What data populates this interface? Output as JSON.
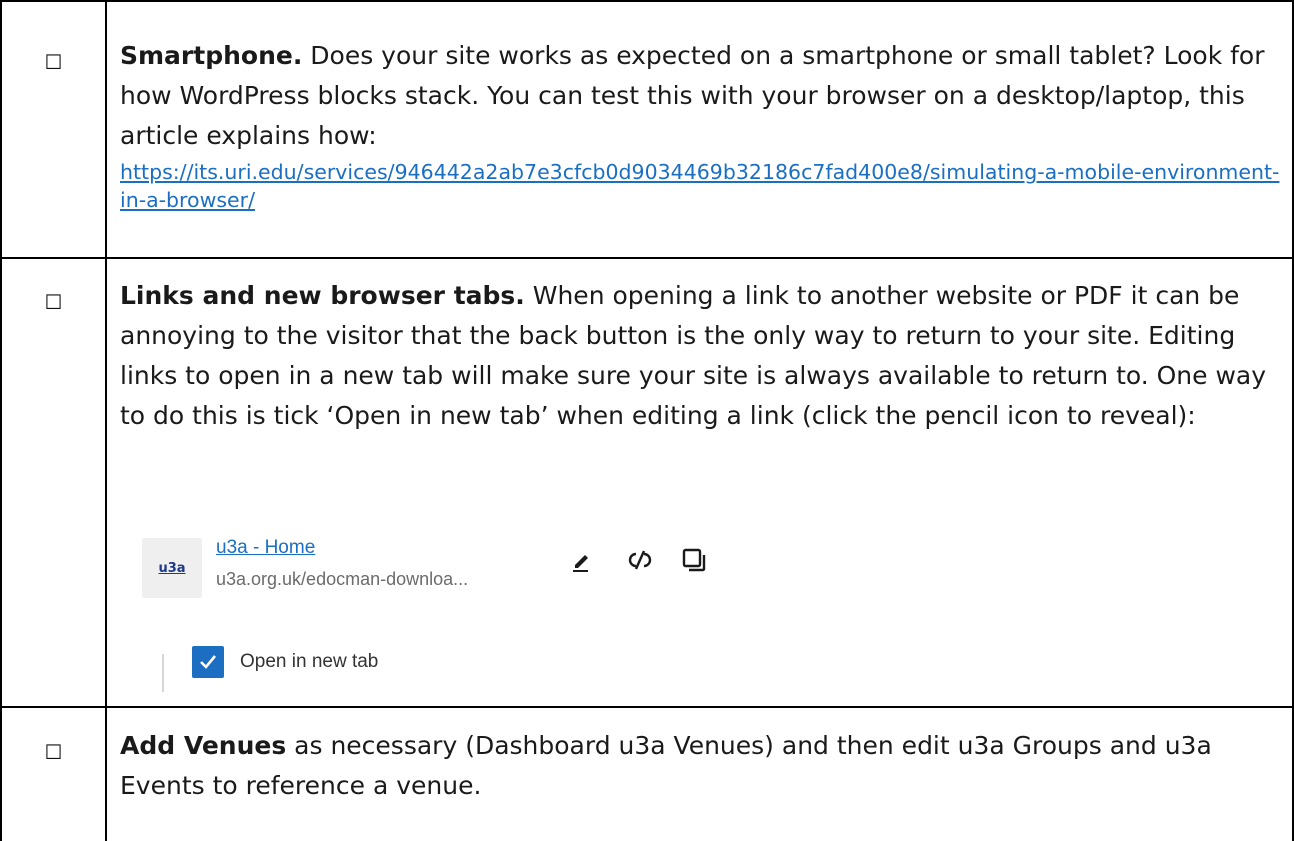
{
  "rows": [
    {
      "checkbox": "☐",
      "title": "Smartphone.",
      "text": " Does your site works as expected on a smartphone or small tablet? Look for how WordPress blocks stack. You can test this with your browser on a desktop/laptop, this article explains how:",
      "link": "https://its.uri.edu/services/946442a2ab7e3cfcb0d9034469b32186c7fad400e8/simulating-a-mobile-environment-in-a-browser/"
    },
    {
      "checkbox": "☐",
      "title": "Links and new browser tabs.",
      "text": " When opening a link to another website or PDF it can be annoying to the visitor that the back button is the only way to return to your site. Editing links to open in a new tab will make sure your site is always available to return to. One way to do this is tick ‘Open in new tab’ when editing a link (click the pencil icon to reveal):"
    },
    {
      "checkbox": "☐",
      "title": "Add Venues",
      "text": " as necessary (Dashboard u3a Venues) and then edit u3a Groups and u3a Events to reference a venue."
    }
  ],
  "link_preview": {
    "favicon_text": "u3a",
    "title": "u3a - Home",
    "url": "u3a.org.uk/edocman-downloa...",
    "tools": [
      "pencil-icon",
      "unlink-icon",
      "copy-icon"
    ],
    "checkbox_checked": true,
    "checkbox_label": "Open in new tab",
    "accent_color": "#1b6ec2"
  }
}
